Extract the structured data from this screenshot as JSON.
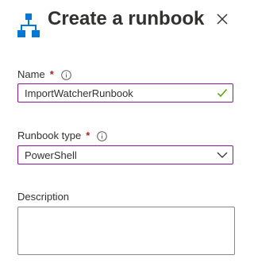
{
  "header": {
    "title": "Create a runbook",
    "icon": "runbook-hierarchy-icon",
    "close_icon": "close-icon"
  },
  "form": {
    "name": {
      "label": "Name",
      "required_mark": "*",
      "value": "ImportWatcherRunbook",
      "valid_icon": "checkmark-icon"
    },
    "runbook_type": {
      "label": "Runbook type",
      "required_mark": "*",
      "selected": "PowerShell",
      "dropdown_icon": "chevron-down-icon"
    },
    "description": {
      "label": "Description",
      "value": ""
    }
  },
  "colors": {
    "accent_border": "#881798",
    "icon_blue": "#0078d4",
    "required": "#a4262c",
    "valid_check": "#57a300"
  }
}
